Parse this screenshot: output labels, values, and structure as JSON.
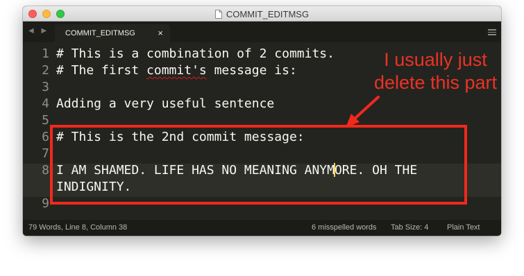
{
  "window": {
    "title": "COMMIT_EDITMSG"
  },
  "tabs": [
    {
      "label": "COMMIT_EDITMSG",
      "close": "×"
    }
  ],
  "nav": {
    "back_forward": "◀ ▶"
  },
  "editor": {
    "lines": [
      {
        "num": "1",
        "text": "# This is a combination of 2 commits."
      },
      {
        "num": "2",
        "pre": "# The first ",
        "misspelled": "commit's",
        "post": " message is:"
      },
      {
        "num": "3",
        "text": ""
      },
      {
        "num": "4",
        "text": "Adding a very useful sentence"
      },
      {
        "num": "5",
        "text": ""
      },
      {
        "num": "6",
        "text": "# This is the 2nd commit message:"
      },
      {
        "num": "7",
        "text": ""
      },
      {
        "num": "8",
        "before_caret": "I AM SHAMED. LIFE HAS NO MEANING ANYM",
        "after_caret": "ORE. OH THE",
        "wrap": "INDIGNITY."
      },
      {
        "num": "9",
        "text": ""
      }
    ],
    "highlighted_line": "8",
    "caret_color": "#f8d848"
  },
  "statusbar": {
    "position": "79 Words, Line 8, Column 38",
    "spelling": "6 misspelled words",
    "tab_size": "Tab Size: 4",
    "syntax": "Plain Text"
  },
  "annotation": {
    "text_line1": "I usually just",
    "text_line2": "delete this part",
    "color": "#f2281c"
  },
  "theme": {
    "editor_bg": "#23241f",
    "text": "#f8f8f2",
    "gutter": "#8f908a"
  }
}
